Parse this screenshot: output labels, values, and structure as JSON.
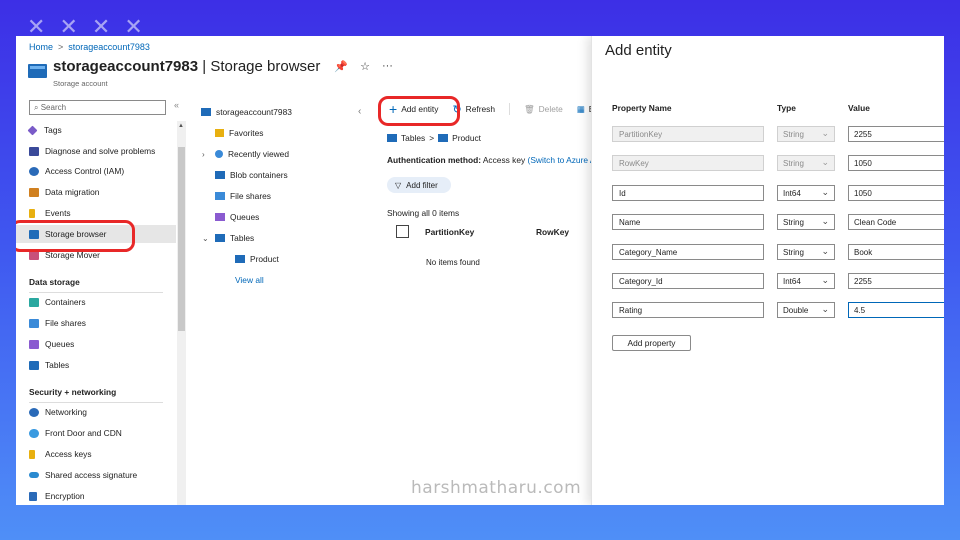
{
  "decoration": [
    "✕",
    "✕",
    "✕",
    "✕"
  ],
  "breadcrumb": {
    "home": "Home",
    "separator": ">",
    "account": "storageaccount7983"
  },
  "header": {
    "account_name": "storageaccount7983",
    "divider": " | ",
    "page_name": "Storage browser",
    "subtitle": "Storage account",
    "icons": [
      "pin-icon",
      "star-icon",
      "more-icon"
    ]
  },
  "search": {
    "placeholder": "Search",
    "collapse": "«"
  },
  "sidebar": {
    "items": [
      {
        "label": "Tags",
        "icon": "tag-icon",
        "color": "#7a5bc8"
      },
      {
        "label": "Diagnose and solve problems",
        "icon": "wrench-icon",
        "color": "#3a4a9a"
      },
      {
        "label": "Access Control (IAM)",
        "icon": "people-icon",
        "color": "#2a6ab8"
      },
      {
        "label": "Data migration",
        "icon": "migration-icon",
        "color": "#d08020"
      },
      {
        "label": "Events",
        "icon": "bolt-icon",
        "color": "#e8b010"
      },
      {
        "label": "Storage browser",
        "icon": "storage-icon",
        "color": "#1f6bb8"
      },
      {
        "label": "Storage Mover",
        "icon": "mover-icon",
        "color": "#c8507a"
      }
    ],
    "data_storage": {
      "heading": "Data storage",
      "items": [
        {
          "label": "Containers",
          "icon": "containers-icon",
          "color": "#2aa8a0"
        },
        {
          "label": "File shares",
          "icon": "file-share-icon",
          "color": "#3a8ad8"
        },
        {
          "label": "Queues",
          "icon": "queue-icon",
          "color": "#8a5bd0"
        },
        {
          "label": "Tables",
          "icon": "table-icon",
          "color": "#1f6bb8"
        }
      ]
    },
    "security": {
      "heading": "Security + networking",
      "items": [
        {
          "label": "Networking",
          "icon": "network-icon",
          "color": "#2a6ab8"
        },
        {
          "label": "Front Door and CDN",
          "icon": "cloud-icon",
          "color": "#3a9ae0"
        },
        {
          "label": "Access keys",
          "icon": "key-icon",
          "color": "#e8b010"
        },
        {
          "label": "Shared access signature",
          "icon": "link-icon",
          "color": "#2a8ad0"
        },
        {
          "label": "Encryption",
          "icon": "lock-icon",
          "color": "#2a6ab8"
        }
      ]
    }
  },
  "tree": {
    "root": "storageaccount7983",
    "favorites": "Favorites",
    "recent": "Recently viewed",
    "blob": "Blob containers",
    "files": "File shares",
    "queues": "Queues",
    "tables": "Tables",
    "product": "Product",
    "view_all": "View all",
    "collapse": "‹"
  },
  "toolbar": {
    "add_entity": "Add entity",
    "refresh": "Refresh",
    "delete": "Delete",
    "edit": "E"
  },
  "content": {
    "bc_tables": "Tables",
    "bc_sep": ">",
    "bc_product": "Product",
    "auth_label": "Authentication method:",
    "auth_value": " Access key ",
    "auth_link": "(Switch to Azure A",
    "add_filter": "Add filter",
    "showing": "Showing all 0 items",
    "col_partition": "PartitionKey",
    "col_row": "RowKey",
    "no_items": "No items found"
  },
  "panel": {
    "title": "Add entity",
    "col_name": "Property Name",
    "col_type": "Type",
    "col_value": "Value",
    "rows": [
      {
        "name": "PartitionKey",
        "type": "String",
        "value": "2255"
      },
      {
        "name": "RowKey",
        "type": "String",
        "value": "1050"
      },
      {
        "name": "Id",
        "type": "Int64",
        "value": "1050"
      },
      {
        "name": "Name",
        "type": "String",
        "value": "Clean Code"
      },
      {
        "name": "Category_Name",
        "type": "String",
        "value": "Book"
      },
      {
        "name": "Category_Id",
        "type": "Int64",
        "value": "2255"
      },
      {
        "name": "Rating",
        "type": "Double",
        "value": "4.5"
      }
    ],
    "add_property": "Add property"
  },
  "watermark": "harshmatharu.com",
  "colors": {
    "accent": "#0067b8",
    "highlight": "#e82828",
    "background_top": "#3d2fe6",
    "background_bottom": "#4f8ff7"
  }
}
